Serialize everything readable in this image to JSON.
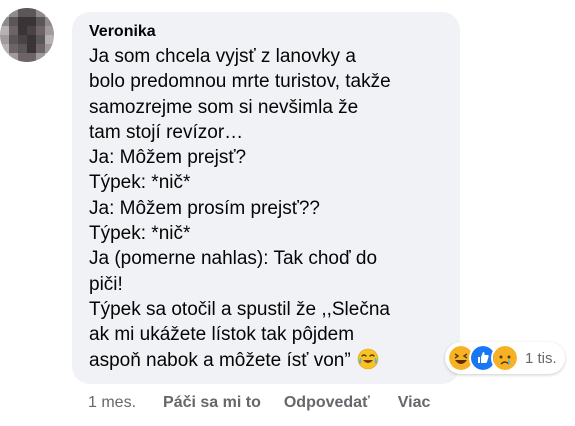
{
  "comment": {
    "author": "Veronika",
    "text": "Ja som chcela vyjsť z lanovky a\nbolo predomnou mrte turistov, takže\nsamozrejme som si nevšimla že\ntam stojí revízor…\nJa: Môžem prejsť?\nTýpek: *nič*\nJa: Môžem prosím prejsť??\nTýpek: *nič*\nJa (pomerne nahlas): Tak choď do\npiči!\nTýpek sa otočil a spustil že ,,Slečna\nak mi ukážete lístok tak pôjdem\naspoň nabok a môžete ísť von”",
    "trailing_emoji": "crying-laughing-face-icon"
  },
  "reactions": {
    "icons": [
      "haha-icon",
      "like-icon",
      "sad-icon"
    ],
    "count": "1 tis."
  },
  "actions": {
    "time": "1 mes.",
    "like": "Páči sa mi to",
    "reply": "Odpovedať",
    "more": "Viac"
  },
  "colors": {
    "bubble_bg": "#f0f2f5",
    "text": "#050505",
    "secondary": "#65676b",
    "like_blue": "#1877f2",
    "emoji_yellow": "#f7b125"
  }
}
